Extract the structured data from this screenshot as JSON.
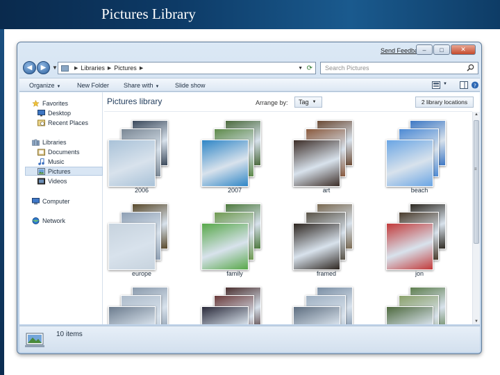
{
  "slide": {
    "title": "Pictures Library"
  },
  "window": {
    "send_feedback": "Send Feedback",
    "minimize_glyph": "–",
    "maximize_glyph": "□",
    "close_glyph": "✕"
  },
  "navigation": {
    "back_glyph": "◀",
    "forward_glyph": "▶",
    "history_glyph": "▼"
  },
  "address": {
    "crumbs": [
      "Libraries",
      "Pictures"
    ],
    "separator": "▶",
    "dropdown_glyph": "▼",
    "refresh_glyph": "⟳"
  },
  "search": {
    "placeholder": "Search Pictures"
  },
  "toolbar": {
    "organize": "Organize",
    "new_folder": "New Folder",
    "share_with": "Share with",
    "slide_show": "Slide show",
    "arrow_glyph": "▼"
  },
  "nav_pane": {
    "favorites": "Favorites",
    "desktop": "Desktop",
    "recent_places": "Recent Places",
    "libraries": "Libraries",
    "documents": "Documents",
    "music": "Music",
    "pictures": "Pictures",
    "videos": "Videos",
    "computer": "Computer",
    "network": "Network"
  },
  "library": {
    "title": "Pictures library",
    "arrange_by_label": "Arrange by:",
    "arrange_by_value": "Tag",
    "locations_button": "2 library locations"
  },
  "folders": [
    {
      "label": "2006",
      "colors": [
        "#3c4a5c",
        "#7a8794",
        "#a9c2d8"
      ]
    },
    {
      "label": "2007",
      "colors": [
        "#4b6a3c",
        "#5e8a4a",
        "#2f86c6"
      ]
    },
    {
      "label": "art",
      "colors": [
        "#6b4a34",
        "#8a5a3e",
        "#3d2e28"
      ]
    },
    {
      "label": "beach",
      "colors": [
        "#3e78c4",
        "#4d8ad4",
        "#6aa5e4"
      ]
    },
    {
      "label": "europe",
      "colors": [
        "#5a4a2c",
        "#8fa0b4",
        "#c7d3de"
      ]
    },
    {
      "label": "family",
      "colors": [
        "#4e7a3e",
        "#6f9a52",
        "#58a84a"
      ]
    },
    {
      "label": "framed",
      "colors": [
        "#7a6a52",
        "#5a5448",
        "#2e2620"
      ]
    },
    {
      "label": "jon",
      "colors": [
        "#2e2a22",
        "#4a3c2c",
        "#c23a3a"
      ]
    },
    {
      "label": "",
      "colors": [
        "#8a9aac",
        "#aebccb",
        "#6c7c8e"
      ]
    },
    {
      "label": "",
      "colors": [
        "#4a2e2e",
        "#6a3a3a",
        "#2a2a3a"
      ]
    },
    {
      "label": "",
      "colors": [
        "#7a8ea4",
        "#9fb0c2",
        "#5e6e80"
      ]
    },
    {
      "label": "",
      "colors": [
        "#5e7e4e",
        "#8aa06a",
        "#4e6a3e"
      ]
    }
  ],
  "status": {
    "item_count": "10 items"
  }
}
